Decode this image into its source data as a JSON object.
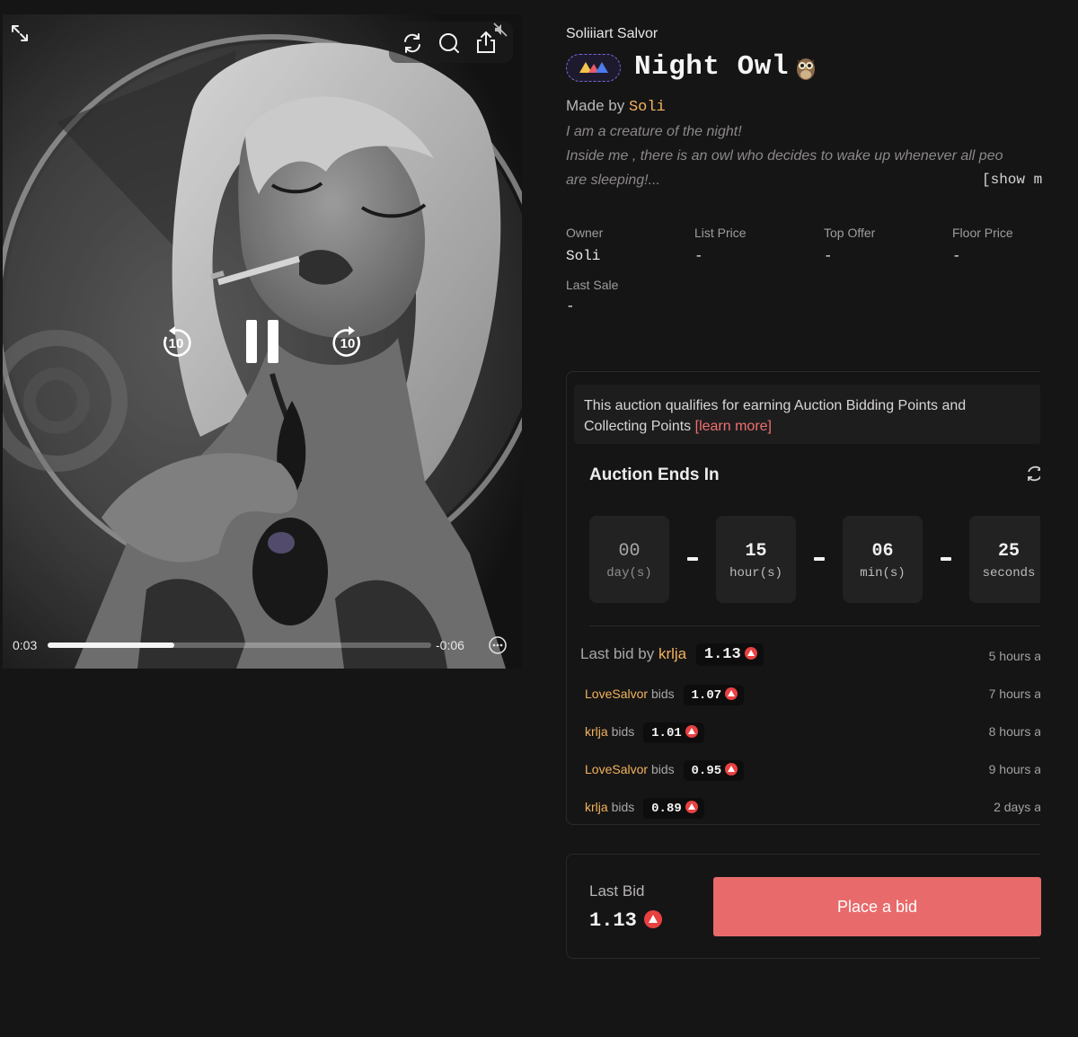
{
  "player": {
    "time_elapsed": "0:03",
    "time_remaining": "-0:06",
    "progress_fraction": 0.33,
    "skip_back_seconds": "10",
    "skip_forward_seconds": "10",
    "state": "playing"
  },
  "collection_name": "Soliiiart Salvor",
  "title": "Night Owl",
  "title_emoji": "🦉",
  "made_by_prefix": "Made by",
  "creator": "Soli",
  "description_lines": [
    "I am a creature of the night!",
    "Inside me , there is an owl who decides to wake up whenever all peo",
    "are sleeping!..."
  ],
  "show_more_label": "[show m",
  "stats": [
    {
      "label": "Owner",
      "value": "Soli"
    },
    {
      "label": "List Price",
      "value": "-"
    },
    {
      "label": "Top Offer",
      "value": "-"
    },
    {
      "label": "Floor Price",
      "value": "-"
    },
    {
      "label": "Last Sale",
      "value": "-"
    }
  ],
  "points_note": {
    "text": "This auction qualifies for earning Auction Bidding Points and Collecting Points",
    "link_label": "[learn more]"
  },
  "auction_title": "Auction Ends In",
  "countdown": [
    {
      "value": "00",
      "unit": "day(s)"
    },
    {
      "value": "15",
      "unit": "hour(s)"
    },
    {
      "value": "06",
      "unit": "min(s)"
    },
    {
      "value": "25",
      "unit": "seconds"
    }
  ],
  "last_bid_row": {
    "prefix": "Last bid by",
    "bidder": "krlja",
    "amount": "1.13",
    "time": "5 hours a"
  },
  "bid_history": [
    {
      "bidder": "LoveSalvor",
      "verb": "bids",
      "amount": "1.07",
      "time": "7 hours a"
    },
    {
      "bidder": "krlja",
      "verb": "bids",
      "amount": "1.01",
      "time": "8 hours a"
    },
    {
      "bidder": "LoveSalvor",
      "verb": "bids",
      "amount": "0.95",
      "time": "9 hours a"
    },
    {
      "bidder": "krlja",
      "verb": "bids",
      "amount": "0.89",
      "time": "2 days a"
    }
  ],
  "bid_card": {
    "label": "Last Bid",
    "value": "1.13",
    "button_label": "Place a bid"
  },
  "colors": {
    "accent": "#e86a6a",
    "link": "#f2b35c",
    "avax": "#e84142",
    "background": "#161516"
  }
}
